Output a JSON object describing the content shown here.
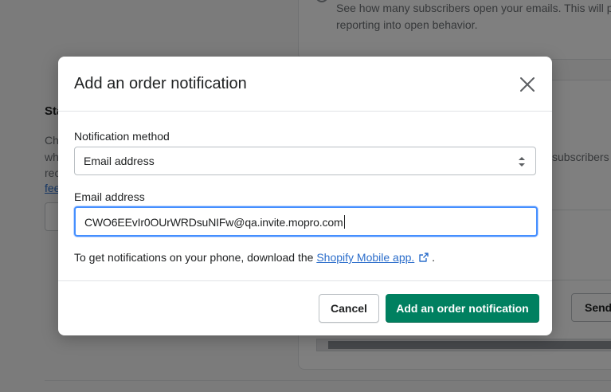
{
  "background": {
    "open_rate_description_line1": "See how many subscribers open your emails. This will pr",
    "open_rate_description_line2": "reporting into open behavior.",
    "section_heading_fragment": "Sta",
    "section_text_fragments": [
      "Ch",
      "wh",
      "rec"
    ],
    "section_link_fragment": "fee",
    "subscribers_fragment": "subscribers w",
    "send_button_fragment": "Send"
  },
  "modal": {
    "title": "Add an order notification",
    "notification_method": {
      "label": "Notification method",
      "selected": "Email address"
    },
    "email": {
      "label": "Email address",
      "value": "CWO6EEvIr0OUrWRDsuNIFw@qa.invite.mopro.com"
    },
    "helper": {
      "text_before": "To get notifications on your phone, download the ",
      "link_text": "Shopify Mobile app.",
      "text_after": " ."
    },
    "buttons": {
      "cancel": "Cancel",
      "primary": "Add an order notification"
    }
  },
  "colors": {
    "primary": "#008060",
    "link": "#2c6ecb",
    "focus_ring": "#458fff"
  },
  "icons": {
    "close": "close-icon",
    "select_arrows": "select-arrows-icon",
    "external_link": "external-link-icon"
  }
}
